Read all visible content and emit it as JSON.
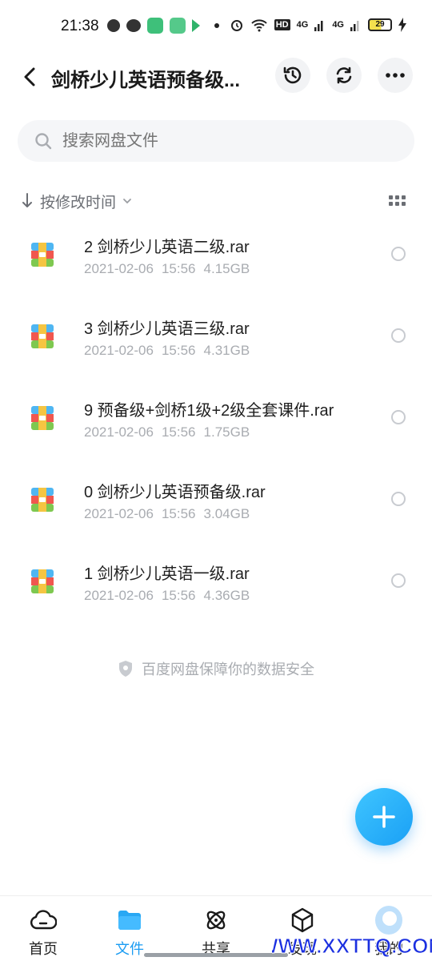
{
  "status_bar": {
    "time": "21:38",
    "network_labels": [
      "HD",
      "4G",
      "4G"
    ],
    "battery": "29"
  },
  "header": {
    "title": "剑桥少儿英语预备级...",
    "icons": [
      "back-arrow-icon",
      "history-icon",
      "sync-icon",
      "more-icon"
    ]
  },
  "search": {
    "placeholder": "搜索网盘文件"
  },
  "sort": {
    "label": "按修改时间"
  },
  "files": [
    {
      "name": "2 剑桥少儿英语二级.rar",
      "date": "2021-02-06",
      "time": "15:56",
      "size": "4.15GB"
    },
    {
      "name": "3 剑桥少儿英语三级.rar",
      "date": "2021-02-06",
      "time": "15:56",
      "size": "4.31GB"
    },
    {
      "name": "9 预备级+剑桥1级+2级全套课件.rar",
      "date": "2021-02-06",
      "time": "15:56",
      "size": "1.75GB"
    },
    {
      "name": "0 剑桥少儿英语预备级.rar",
      "date": "2021-02-06",
      "time": "15:56",
      "size": "3.04GB"
    },
    {
      "name": "1 剑桥少儿英语一级.rar",
      "date": "2021-02-06",
      "time": "15:56",
      "size": "4.36GB"
    }
  ],
  "safety_note": "百度网盘保障你的数据安全",
  "bottom_nav": [
    {
      "label": "首页",
      "icon": "cloud-icon",
      "active": false
    },
    {
      "label": "文件",
      "icon": "folder-icon",
      "active": true
    },
    {
      "label": "共享",
      "icon": "atom-icon",
      "active": false
    },
    {
      "label": "发现",
      "icon": "cube-icon",
      "active": false
    },
    {
      "label": "我的",
      "icon": "avatar-icon",
      "active": false
    }
  ],
  "watermark": "WWW.XXTTQ.COM",
  "colors": {
    "accent": "#1b9cf2",
    "fab": "#25adf7",
    "watermark": "#1a2fe0"
  }
}
